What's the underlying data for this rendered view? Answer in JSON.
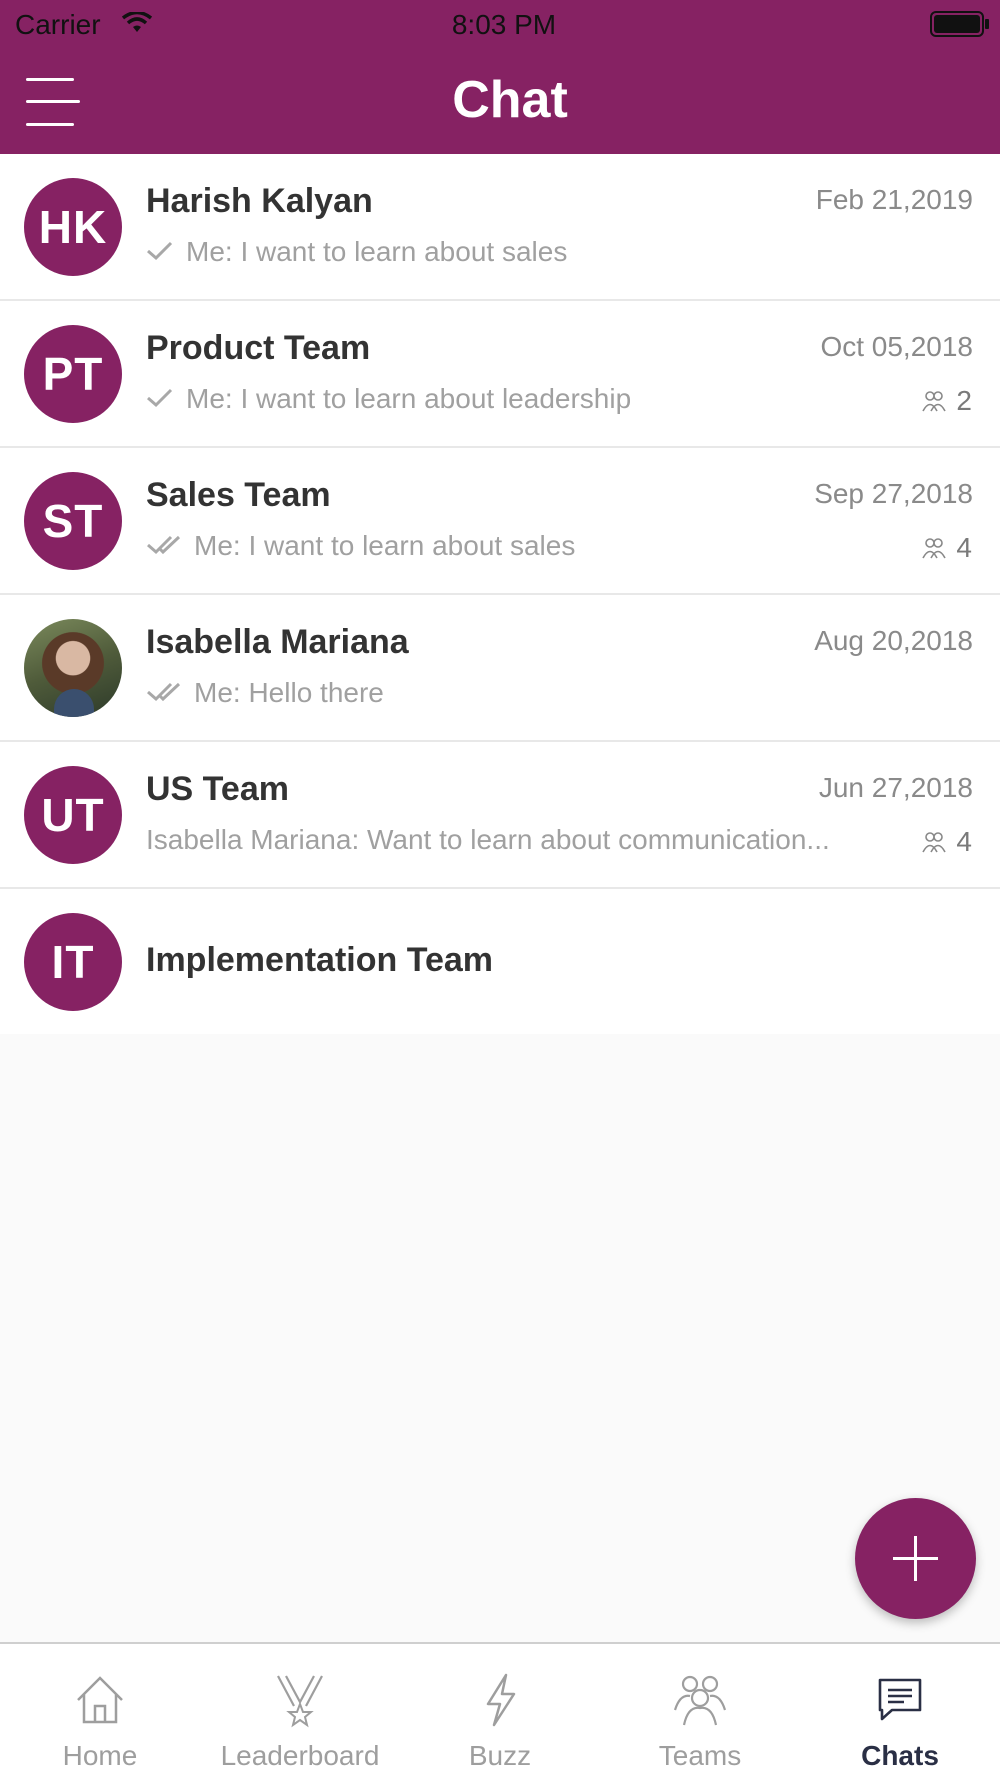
{
  "status_bar": {
    "carrier": "Carrier",
    "time": "8:03 PM"
  },
  "header": {
    "title": "Chat",
    "menu_icon": "hamburger-menu-icon"
  },
  "accent_color": "#862263",
  "chats": [
    {
      "initials": "HK",
      "name": "Harish Kalyan",
      "date": "Feb 21,2019",
      "preview": "Me: I want to learn about sales",
      "tick": "single",
      "members": null
    },
    {
      "initials": "PT",
      "name": "Product Team",
      "date": "Oct 05,2018",
      "preview": "Me: I want to learn about leadership",
      "tick": "single",
      "members": "2"
    },
    {
      "initials": "ST",
      "name": "Sales Team",
      "date": "Sep 27,2018",
      "preview": "Me: I want to learn about sales",
      "tick": "double",
      "members": "4"
    },
    {
      "initials": "",
      "photo": true,
      "name": "Isabella Mariana",
      "date": "Aug 20,2018",
      "preview": "Me: Hello there",
      "tick": "double",
      "members": null
    },
    {
      "initials": "UT",
      "name": "US Team",
      "date": "Jun 27,2018",
      "preview": "Isabella Mariana: Want to learn about communication...",
      "tick": "none",
      "members": "4"
    },
    {
      "initials": "IT",
      "name": "Implementation Team",
      "date": "",
      "preview": "",
      "tick": "none",
      "members": null
    }
  ],
  "fab": {
    "icon": "plus-icon"
  },
  "tabs": [
    {
      "label": "Home",
      "icon": "home-icon",
      "active": false
    },
    {
      "label": "Leaderboard",
      "icon": "medal-icon",
      "active": false
    },
    {
      "label": "Buzz",
      "icon": "lightning-icon",
      "active": false
    },
    {
      "label": "Teams",
      "icon": "people-icon",
      "active": false
    },
    {
      "label": "Chats",
      "icon": "chat-bubble-icon",
      "active": true
    }
  ]
}
